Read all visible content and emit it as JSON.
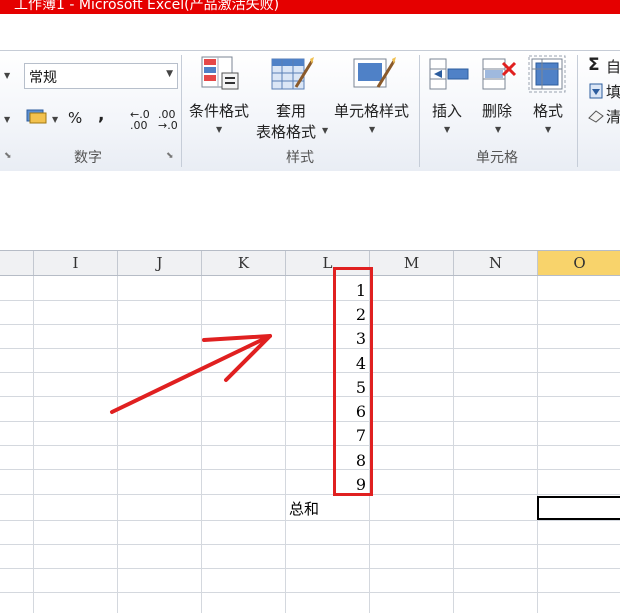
{
  "window": {
    "title": "工作簿1 - Microsoft Excel(产品激活失败)"
  },
  "ribbon": {
    "number_group": {
      "format_value": "常规",
      "percent": "%",
      "comma": ",",
      "increase_decimal": "←.0 .00",
      "decrease_decimal": ".00 →.0",
      "label": "数字"
    },
    "styles_group": {
      "conditional_format": "条件格式",
      "table_format_line1": "套用",
      "table_format_line2": "表格格式",
      "cell_styles": "单元格样式",
      "label": "样式"
    },
    "cells_group": {
      "insert": "插入",
      "delete": "删除",
      "format": "格式",
      "label": "单元格"
    },
    "editing_group": {
      "autosum_icon": "Σ",
      "autosum": "自",
      "fill": "填",
      "clear": "清"
    }
  },
  "columns": [
    "I",
    "J",
    "K",
    "L",
    "M",
    "N",
    "O"
  ],
  "selected_column": "O",
  "cells": {
    "L_values": [
      "1",
      "2",
      "3",
      "4",
      "5",
      "6",
      "7",
      "8",
      "9"
    ],
    "sum_label": "总和"
  },
  "colors": {
    "title_bar": "#e50000",
    "annotation": "#e02020",
    "selected_header": "#f8d36b"
  }
}
